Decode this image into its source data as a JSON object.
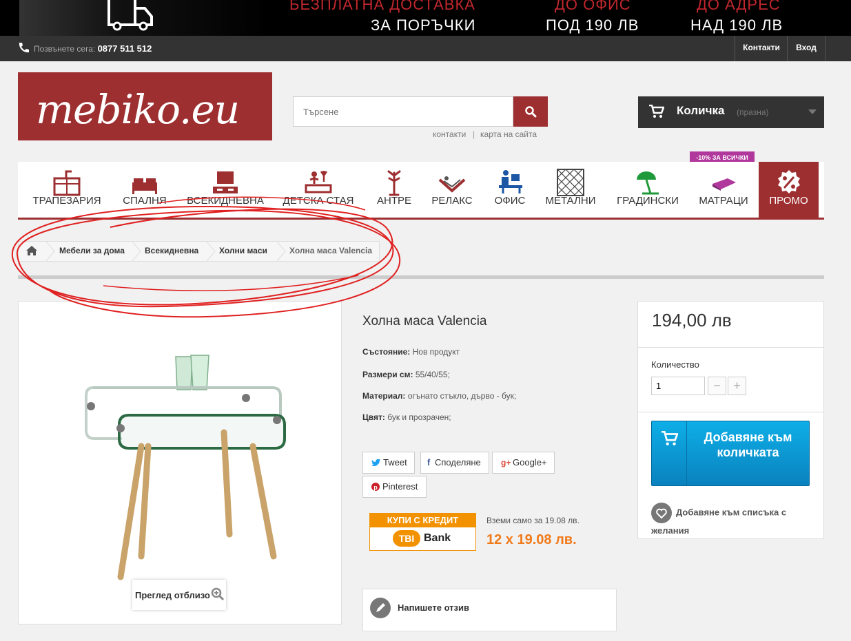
{
  "promo": {
    "col1_line1": "БЕЗПЛАТНА ДОСТАВКА",
    "col1_line2": "ЗА ПОРЪЧКИ",
    "col2_line1": "ДО ОФИС",
    "col2_line2": "ПОД 190 ЛВ",
    "col3_line1": "ДО АДРЕС",
    "col3_line2": "НАД 190 ЛВ"
  },
  "topnav": {
    "call_label": "Позвънете сега:",
    "phone": "0877 511 512",
    "contacts": "Контакти",
    "login": "Вход"
  },
  "logo": {
    "text": "mebiko.eu"
  },
  "search": {
    "placeholder": "Търсене",
    "link_contacts": "контакти",
    "link_sitemap": "карта на сайта"
  },
  "cart": {
    "title": "Количка",
    "status": "(празна)"
  },
  "menu": {
    "discount_badge": "-10% ЗА ВСИЧКИ",
    "items": [
      {
        "label": "ТРАПЕЗАРИЯ"
      },
      {
        "label": "СПАЛНЯ"
      },
      {
        "label": "ВСЕКИДНЕВНА"
      },
      {
        "label": "ДЕТСКА СТАЯ"
      },
      {
        "label": "АНТРЕ"
      },
      {
        "label": "РЕЛАКС"
      },
      {
        "label": "ОФИС"
      },
      {
        "label": "МЕТАЛНИ"
      },
      {
        "label": "ГРАДИНСКИ"
      },
      {
        "label": "МАТРАЦИ"
      },
      {
        "label": "ПРОМО"
      }
    ]
  },
  "breadcrumb": {
    "items": [
      "Мебели за дома",
      "Всекидневна",
      "Холни маси",
      "Холна маса Valencia"
    ]
  },
  "product": {
    "title": "Холна маса Valencia",
    "zoom_label": "Преглед отблизо",
    "attributes": [
      {
        "label": "Състояние:",
        "value": "Нов продукт"
      },
      {
        "label": "Размери см:",
        "value": "55/40/55;"
      },
      {
        "label": "Материал:",
        "value": "огънато стъкло, дърво - бук;"
      },
      {
        "label": "Цвят:",
        "value": "бук и прозрачен;"
      }
    ],
    "social": {
      "tweet": "Tweet",
      "share": "Споделяне",
      "google": "Google+",
      "pinterest": "Pinterest"
    },
    "credit": {
      "banner_title": "КУПИ С КРЕДИТ",
      "bank_tbi": "TBI",
      "bank_name": "Bank",
      "note": "Вземи само за 19.08 лв.",
      "installment": "12 x 19.08 лв."
    },
    "review": "Напишете отзив"
  },
  "buybox": {
    "price": "194,00 лв",
    "qty_label": "Количество",
    "qty_value": "1",
    "minus": "−",
    "plus": "+",
    "add_to_cart": "Добавяне към количката",
    "wishlist": "Добавяне към списъка с желания"
  },
  "colors": {
    "brand_red": "#9e2f31",
    "dark": "#333333",
    "cta_blue": "#0a82be",
    "tbi_orange": "#f39200",
    "annotation_red": "#e02020"
  }
}
